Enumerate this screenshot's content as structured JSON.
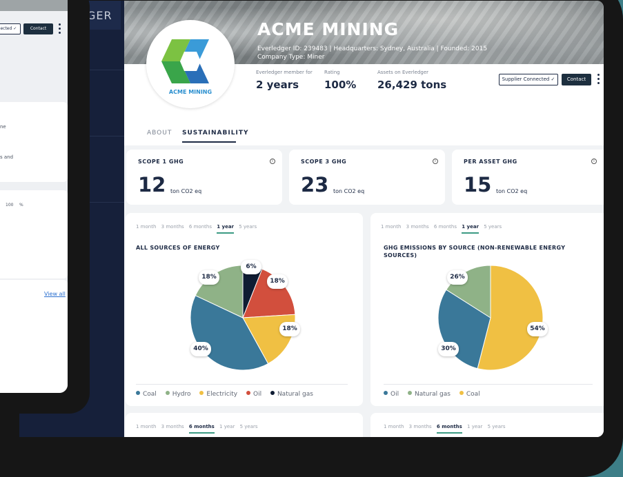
{
  "company": {
    "name": "ACME MINING",
    "meta_line1": "Everledger ID: 239483  |  Headquarters: Sydney, Australia  |  Founded: 2015",
    "meta_line2": "Company Type: Miner",
    "logo_text": "ACME MINING"
  },
  "sidebar": {
    "brand": "GER"
  },
  "stats": [
    {
      "label": "Everledger member for",
      "value": "2 years"
    },
    {
      "label": "Rating",
      "value": "100%"
    },
    {
      "label": "Assets on Everledger",
      "value": "26,429 tons"
    }
  ],
  "actions": {
    "supplier": "Supplier Connected ✓",
    "contact": "Contact"
  },
  "tabs": {
    "about": "ABOUT",
    "sustainability": "SUSTAINABILITY"
  },
  "ghg_cards": [
    {
      "title": "SCOPE 1 GHG",
      "value": "12",
      "unit": "ton CO2 eq"
    },
    {
      "title": "SCOPE 3 GHG",
      "value": "23",
      "unit": "ton CO2 eq"
    },
    {
      "title": "PER ASSET GHG",
      "value": "15",
      "unit": "ton CO2 eq"
    }
  ],
  "ranges": [
    "1 month",
    "3 months",
    "6 months",
    "1 year",
    "5 years"
  ],
  "charts": [
    {
      "title": "ALL SOURCES OF ENERGY",
      "active_range": "1 year",
      "slices": [
        {
          "name": "Natural gas",
          "value": 6,
          "label": "6%",
          "color": "#0f1c33"
        },
        {
          "name": "Oil",
          "value": 18,
          "label": "18%",
          "color": "#d24f3d"
        },
        {
          "name": "Electricity",
          "value": 18,
          "label": "18%",
          "color": "#f0c043"
        },
        {
          "name": "Coal",
          "value": 40,
          "label": "40%",
          "color": "#3a7899"
        },
        {
          "name": "Hydro",
          "value": 18,
          "label": "18%",
          "color": "#8fb287"
        }
      ],
      "legend": [
        {
          "name": "Coal",
          "color": "#3a7899"
        },
        {
          "name": "Hydro",
          "color": "#8fb287"
        },
        {
          "name": "Electricity",
          "color": "#f0c043"
        },
        {
          "name": "Oil",
          "color": "#d24f3d"
        },
        {
          "name": "Natural gas",
          "color": "#0f1c33"
        }
      ]
    },
    {
      "title_line1": "GHG EMISSIONS BY SOURCE (NON-RENEWABLE ENERGY",
      "title_line2": "SOURCES)",
      "active_range": "1 year",
      "slices": [
        {
          "name": "Coal",
          "value": 54,
          "label": "54%",
          "color": "#f0c043"
        },
        {
          "name": "Oil",
          "value": 30,
          "label": "30%",
          "color": "#3a7899"
        },
        {
          "name": "Natural gas",
          "value": 16,
          "label": "26%",
          "color": "#8fb287"
        }
      ],
      "legend": [
        {
          "name": "Oil",
          "color": "#3a7899"
        },
        {
          "name": "Natural gas",
          "color": "#8fb287"
        },
        {
          "name": "Coal",
          "color": "#f0c043"
        }
      ]
    }
  ],
  "bottom_active_range": "6 months",
  "left_device": {
    "supplier": "Connected ✓",
    "contact": "Contact",
    "text1": "ne",
    "text2": "s and",
    "val1": "100",
    "val2": "%",
    "view_all": "View all"
  },
  "chart_data": [
    {
      "type": "pie",
      "title": "ALL SOURCES OF ENERGY",
      "categories": [
        "Natural gas",
        "Oil",
        "Electricity",
        "Coal",
        "Hydro"
      ],
      "values": [
        6,
        18,
        18,
        40,
        18
      ]
    },
    {
      "type": "pie",
      "title": "GHG EMISSIONS BY SOURCE (NON-RENEWABLE ENERGY SOURCES)",
      "categories": [
        "Coal",
        "Oil",
        "Natural gas"
      ],
      "values": [
        54,
        30,
        26
      ]
    }
  ]
}
